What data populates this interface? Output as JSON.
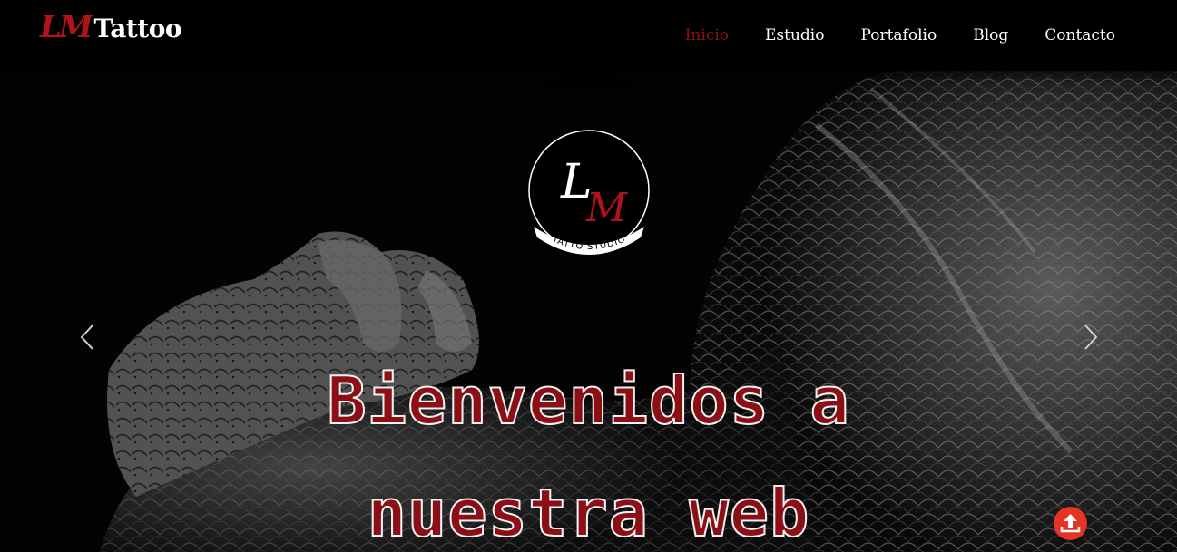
{
  "brand": {
    "initials": "LM",
    "name": "Tattoo"
  },
  "nav": {
    "items": [
      {
        "label": "Inicio",
        "active": true
      },
      {
        "label": "Estudio",
        "active": false
      },
      {
        "label": "Portafolio",
        "active": false
      },
      {
        "label": "Blog",
        "active": false
      },
      {
        "label": "Contacto",
        "active": false
      }
    ]
  },
  "hero": {
    "badge": {
      "initials_top": "L",
      "initials_bottom": "M",
      "ribbon": "TATTO STUDIO"
    },
    "title_line1": "Bienvenidos a",
    "title_line2": "nuestra web",
    "prev_icon": "chevron-left-icon",
    "next_icon": "chevron-right-icon"
  },
  "scroll_top_icon": "upload-arrow-icon",
  "colors": {
    "accent": "#8b0f14",
    "nav_active": "#8a1016",
    "scroll_button": "#e53325",
    "background": "#000000"
  }
}
